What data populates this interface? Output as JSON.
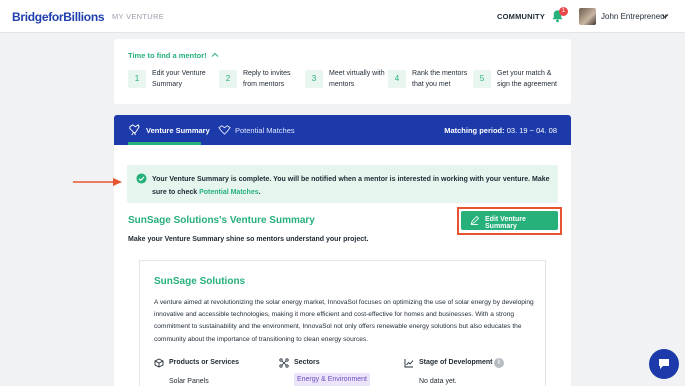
{
  "nav": {
    "logo": "BridgeforBillions",
    "my_venture": "MY VENTURE",
    "community": "COMMUNITY",
    "notification_count": "1",
    "user_name": "John Entrepreneur"
  },
  "mentor": {
    "title": "Time to find a mentor!",
    "steps": [
      {
        "num": "1",
        "line1": "Edit your Venture",
        "line2": "Summary"
      },
      {
        "num": "2",
        "line1": "Reply to invites",
        "line2": "from mentors"
      },
      {
        "num": "3",
        "line1": "Meet virtually with",
        "line2": "mentors"
      },
      {
        "num": "4",
        "line1": "Rank the mentors",
        "line2": "that you met"
      },
      {
        "num": "5",
        "line1": "Get your match &",
        "line2": "sign the agreement"
      }
    ]
  },
  "tabs": {
    "venture_summary": "Venture Summary",
    "potential_matches": "Potential Matches",
    "matching_label": "Matching period:",
    "matching_value": "03. 19 ~ 04. 08"
  },
  "alert": {
    "text": "Your Venture Summary is complete. You will be notified when a mentor is interested in working with your venture. Make sure to check",
    "link": "Potential Matches",
    "end": "."
  },
  "summary": {
    "title": "SunSage Solutions's Venture Summary",
    "subtitle": "Make your Venture Summary shine so mentors understand your project.",
    "edit_button": "Edit Venture Summary"
  },
  "venture": {
    "name": "SunSage Solutions",
    "description": "A venture aimed at revolutionizing the solar energy market, InnovaSol focuses on optimizing the use of solar energy by developing innovative and accessible technologies, making it more efficient and cost-effective for homes and businesses. With a strong commitment to sustainability and the environment, InnovaSol not only offers renewable energy solutions but also educates the community about the importance of transitioning to clean energy sources.",
    "products_label": "Products or Services",
    "products_value": "Solar Panels",
    "sectors_label": "Sectors",
    "sectors_value": "Energy & Environment",
    "stage_label": "Stage of Development",
    "stage_value": "No data yet."
  },
  "colors": {
    "brand_blue": "#1c3aa9",
    "green": "#27b07a",
    "highlight_red": "#e8542f"
  }
}
